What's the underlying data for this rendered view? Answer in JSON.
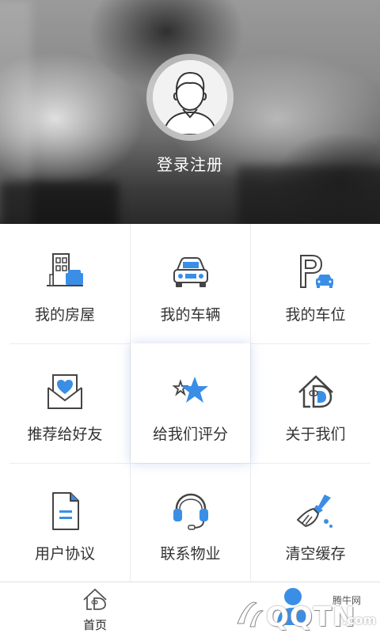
{
  "header": {
    "login_label": "登录注册"
  },
  "menu": {
    "items": [
      {
        "label": "我的房屋",
        "icon": "house-icon"
      },
      {
        "label": "我的车辆",
        "icon": "car-icon"
      },
      {
        "label": "我的车位",
        "icon": "parking-icon"
      },
      {
        "label": "推荐给好友",
        "icon": "heart-envelope-icon"
      },
      {
        "label": "给我们评分",
        "icon": "star-icon"
      },
      {
        "label": "关于我们",
        "icon": "about-logo-icon"
      },
      {
        "label": "用户协议",
        "icon": "document-icon"
      },
      {
        "label": "联系物业",
        "icon": "headset-icon"
      },
      {
        "label": "清空缓存",
        "icon": "broom-icon"
      }
    ]
  },
  "bottom_nav": {
    "home_label": "首页"
  },
  "watermark": {
    "site_label": "腾牛网",
    "brand": "QQTN",
    "suffix": ".com"
  },
  "colors": {
    "accent": "#3a8ee6",
    "outline": "#444444",
    "text": "#333333"
  }
}
